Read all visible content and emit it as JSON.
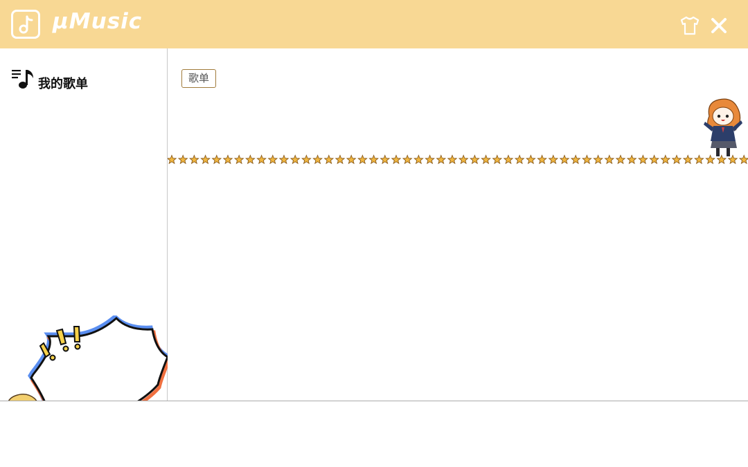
{
  "header": {
    "app_title": "µMusic",
    "logo_icon": "music-note-icon",
    "skin_icon": "tshirt-icon",
    "close_icon": "close-icon",
    "background_color": "#f8d894"
  },
  "sidebar": {
    "items": [
      {
        "label": "我的歌单",
        "icon": "playlist-icon"
      }
    ]
  },
  "main": {
    "tabs": [
      {
        "label": "歌单"
      }
    ]
  }
}
